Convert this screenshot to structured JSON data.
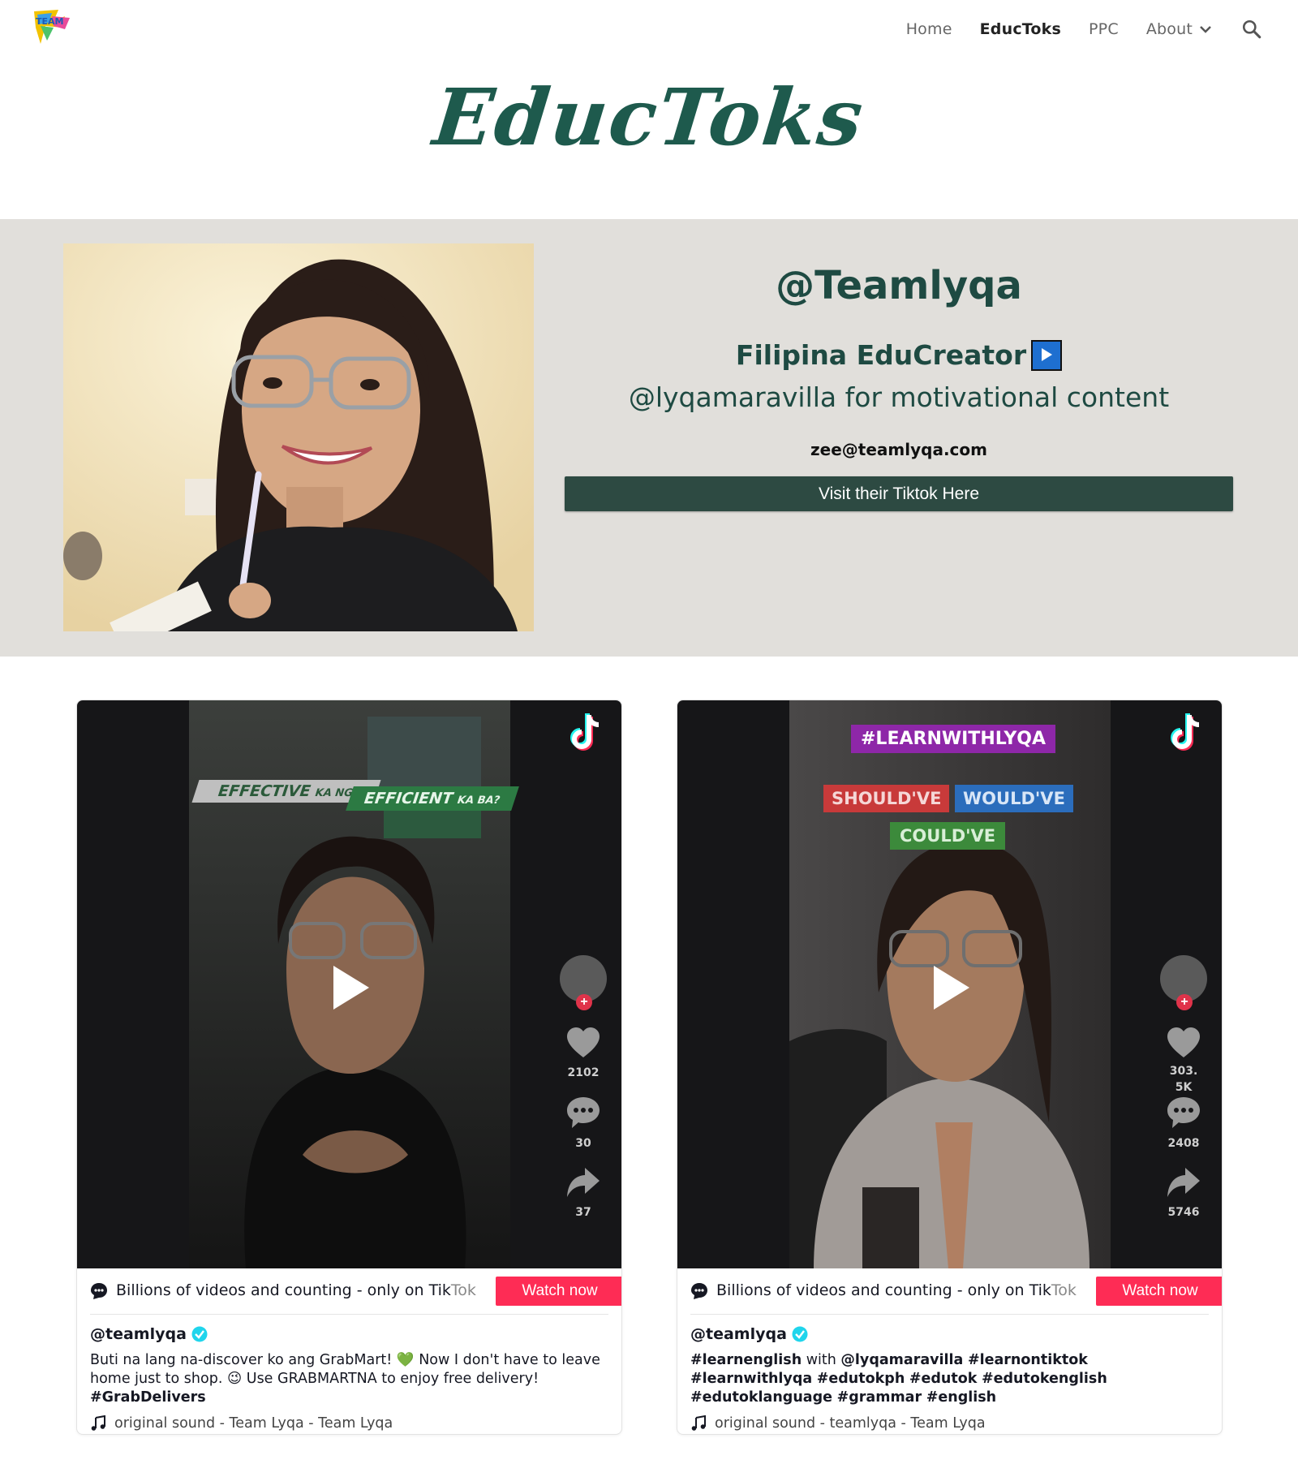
{
  "nav": {
    "items": [
      {
        "label": "Home",
        "active": false
      },
      {
        "label": "EducToks",
        "active": true
      },
      {
        "label": "PPC",
        "active": false
      },
      {
        "label": "About",
        "active": false,
        "has_dropdown": true
      }
    ],
    "search_icon": "search-icon"
  },
  "page": {
    "title": "EducToks"
  },
  "hero": {
    "handle": "@Teamlyqa",
    "subtitle": "Filipina EduCreator",
    "tagline": "@lyqamaravilla for motivational content",
    "email": "zee@teamlyqa.com",
    "visit_button": "Visit their Tiktok Here"
  },
  "colors": {
    "brand_green": "#1e4a42",
    "hero_bg": "#e1dfdb",
    "button_bg": "#2d4a42",
    "tiktok_red": "#fe2c55"
  },
  "cards": [
    {
      "overlay": [
        "EFFECTIVE",
        "KA NGA,",
        "EFFICIENT",
        "KA BA?"
      ],
      "likes": "2102",
      "comments": "30",
      "shares": "37",
      "promo_text": "Billions of videos and counting - only on Tik",
      "promo_tail": "Tok",
      "watch_button": "Watch now",
      "username": "@teamlyqa",
      "caption_text": "Buti na lang na-discover ko ang GrabMart! 💚 Now I don't have to leave home just to shop. 😉 Use GRABMARTNA to enjoy free delivery! ",
      "caption_hash": "#GrabDelivers",
      "sound": "original sound - Team Lyqa - Team Lyqa"
    },
    {
      "overlay": [
        "#LEARNWITHLYQA",
        "SHOULD'VE",
        "WOULD'VE",
        "COULD'VE"
      ],
      "likes": "303.5K",
      "comments": "2408",
      "shares": "5746",
      "promo_text": "Billions of videos and counting - only on Tik",
      "promo_tail": "Tok",
      "watch_button": "Watch now",
      "username": "@teamlyqa",
      "caption_parts": [
        "#learnenglish",
        " with ",
        "@lyqamaravilla",
        " ",
        "#learnontiktok",
        " ",
        "#learnwithlyqa",
        " ",
        "#edutokph",
        " ",
        "#edutok",
        " ",
        "#edutokenglish",
        " ",
        "#edutoklanguage",
        " ",
        "#grammar",
        " ",
        "#english"
      ],
      "sound": "original sound - teamlyqa - Team Lyqa"
    }
  ]
}
